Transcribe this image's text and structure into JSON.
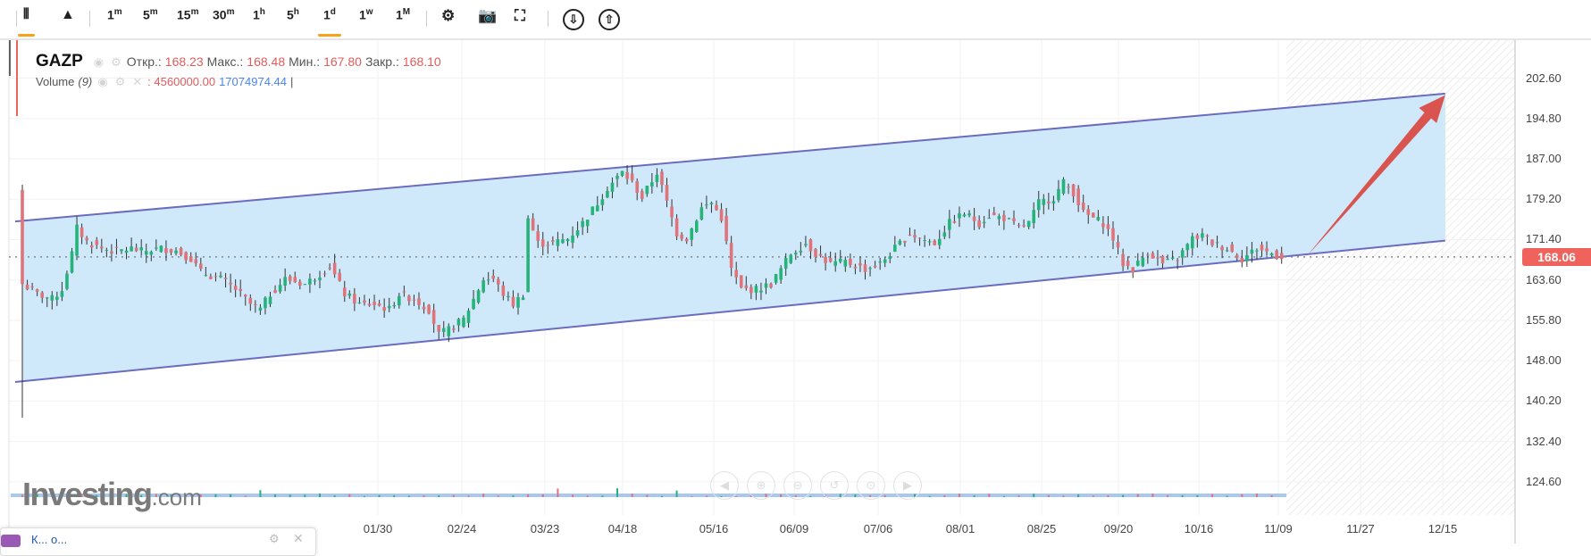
{
  "toolbar": {
    "chart_types": [
      {
        "name": "candles",
        "glyph": "⫴"
      },
      {
        "name": "area",
        "glyph": "▲"
      }
    ],
    "intervals": [
      {
        "base": "1",
        "sup": "m"
      },
      {
        "base": "5",
        "sup": "m"
      },
      {
        "base": "15",
        "sup": "m"
      },
      {
        "base": "30",
        "sup": "m"
      },
      {
        "base": "1",
        "sup": "h"
      },
      {
        "base": "5",
        "sup": "h"
      },
      {
        "base": "1",
        "sup": "d"
      },
      {
        "base": "1",
        "sup": "w"
      },
      {
        "base": "1",
        "sup": "M"
      }
    ],
    "active_interval": "1d",
    "tools": [
      {
        "name": "settings",
        "glyph": "⚙"
      },
      {
        "name": "screenshot",
        "glyph": "📷"
      },
      {
        "name": "fullscreen",
        "glyph": "⛶"
      }
    ],
    "cloud": [
      {
        "name": "download-cloud",
        "glyph": "⇩"
      },
      {
        "name": "upload-cloud",
        "glyph": "⇧"
      }
    ]
  },
  "legend": {
    "symbol": "GAZP",
    "open_label": "Откр.:",
    "open": "168.23",
    "high_label": "Макс.:",
    "high": "168.48",
    "low_label": "Мин.:",
    "low": "167.80",
    "close_label": "Закр.:",
    "close": "168.10",
    "volume_label": "Volume",
    "volume_param": "(9)",
    "volume_value": ": 4560000.00",
    "volume_ma": "17074974.44",
    "cursor": "|"
  },
  "logo": {
    "main": "Investing",
    "suffix": ".com"
  },
  "popup": {
    "title": "К... о..."
  },
  "colors": {
    "up": "#26b37a",
    "down": "#e0737a",
    "channel_fill": "#cce8fb",
    "channel_line": "#6b6bbf",
    "arrow": "#d9534f",
    "price_tag": "#f0635c"
  },
  "chart_data": {
    "type": "candlestick",
    "symbol": "GAZP",
    "interval": "1d",
    "y_ticks": [
      "202.60",
      "194.80",
      "187.00",
      "179.20",
      "171.40",
      "163.60",
      "155.80",
      "148.00",
      "140.20",
      "132.40",
      "124.60"
    ],
    "ylim": [
      124.6,
      202.6
    ],
    "x_ticks": [
      "01/30",
      "02/24",
      "03/23",
      "04/18",
      "05/16",
      "06/09",
      "07/06",
      "08/01",
      "08/25",
      "09/20",
      "10/16",
      "11/09",
      "11/27",
      "12/15"
    ],
    "last_price": "168.06",
    "close_path": [
      [
        0,
        162.8
      ],
      [
        3,
        160.9
      ],
      [
        6,
        159.9
      ],
      [
        8,
        161.8
      ],
      [
        10,
        168.7
      ],
      [
        11,
        173.6
      ],
      [
        13,
        171.0
      ],
      [
        16,
        169.7
      ],
      [
        19,
        169.1
      ],
      [
        22,
        169.7
      ],
      [
        24,
        169.1
      ],
      [
        28,
        169.7
      ],
      [
        31,
        169.3
      ],
      [
        34,
        167.7
      ],
      [
        36,
        165.1
      ],
      [
        40,
        163.8
      ],
      [
        43,
        161.8
      ],
      [
        46,
        158.9
      ],
      [
        48,
        157.9
      ],
      [
        50,
        160.9
      ],
      [
        53,
        163.8
      ],
      [
        57,
        162.8
      ],
      [
        60,
        164.8
      ],
      [
        62,
        166.3
      ],
      [
        65,
        160.9
      ],
      [
        68,
        158.9
      ],
      [
        71,
        158.9
      ],
      [
        74,
        157.9
      ],
      [
        76,
        160.9
      ],
      [
        79,
        159.9
      ],
      [
        82,
        157.9
      ],
      [
        84,
        153.0
      ],
      [
        86,
        154.0
      ],
      [
        89,
        156.0
      ],
      [
        91,
        159.9
      ],
      [
        93,
        163.8
      ],
      [
        95,
        163.8
      ],
      [
        97,
        160.9
      ],
      [
        99,
        158.9
      ],
      [
        101,
        160.9
      ],
      [
        102,
        175.6
      ],
      [
        104,
        170.7
      ],
      [
        107,
        170.7
      ],
      [
        110,
        171.6
      ],
      [
        113,
        174.6
      ],
      [
        116,
        178.5
      ],
      [
        118,
        181.4
      ],
      [
        121,
        184.4
      ],
      [
        123,
        182.4
      ],
      [
        125,
        179.5
      ],
      [
        128,
        184.4
      ],
      [
        130,
        178.5
      ],
      [
        132,
        172.6
      ],
      [
        134,
        171.6
      ],
      [
        137,
        177.5
      ],
      [
        139,
        178.5
      ],
      [
        141,
        175.6
      ],
      [
        143,
        165.7
      ],
      [
        145,
        161.8
      ],
      [
        148,
        161.8
      ],
      [
        151,
        162.8
      ],
      [
        153,
        165.7
      ],
      [
        155,
        168.7
      ],
      [
        158,
        170.7
      ],
      [
        160,
        168.7
      ],
      [
        163,
        166.7
      ],
      [
        166,
        167.1
      ],
      [
        170,
        165.7
      ],
      [
        173,
        166.7
      ],
      [
        176,
        169.7
      ],
      [
        179,
        172.6
      ],
      [
        181,
        171.6
      ],
      [
        184,
        170.7
      ],
      [
        187,
        174.6
      ],
      [
        190,
        176.5
      ],
      [
        193,
        174.6
      ],
      [
        195,
        176.1
      ],
      [
        198,
        175.6
      ],
      [
        201,
        173.6
      ],
      [
        203,
        174.6
      ],
      [
        205,
        178.5
      ],
      [
        208,
        179.5
      ],
      [
        210,
        182.4
      ],
      [
        212,
        180.5
      ],
      [
        214,
        176.5
      ],
      [
        218,
        174.6
      ],
      [
        220,
        171.6
      ],
      [
        222,
        166.7
      ],
      [
        224,
        165.7
      ],
      [
        227,
        169.1
      ],
      [
        230,
        166.7
      ],
      [
        233,
        167.7
      ],
      [
        236,
        171.6
      ],
      [
        238,
        172.2
      ],
      [
        240,
        170.7
      ],
      [
        243,
        169.7
      ],
      [
        246,
        167.7
      ],
      [
        249,
        169.7
      ],
      [
        252,
        168.7
      ],
      [
        254,
        168.1
      ]
    ],
    "channel": {
      "upper": [
        [
          0,
          174.9
        ],
        [
          287,
          199.6
        ]
      ],
      "lower": [
        [
          0,
          143.9
        ],
        [
          287,
          171.2
        ]
      ]
    },
    "projection_arrow": {
      "from": [
        259,
        168.1
      ],
      "to": [
        287,
        199.3
      ]
    }
  }
}
